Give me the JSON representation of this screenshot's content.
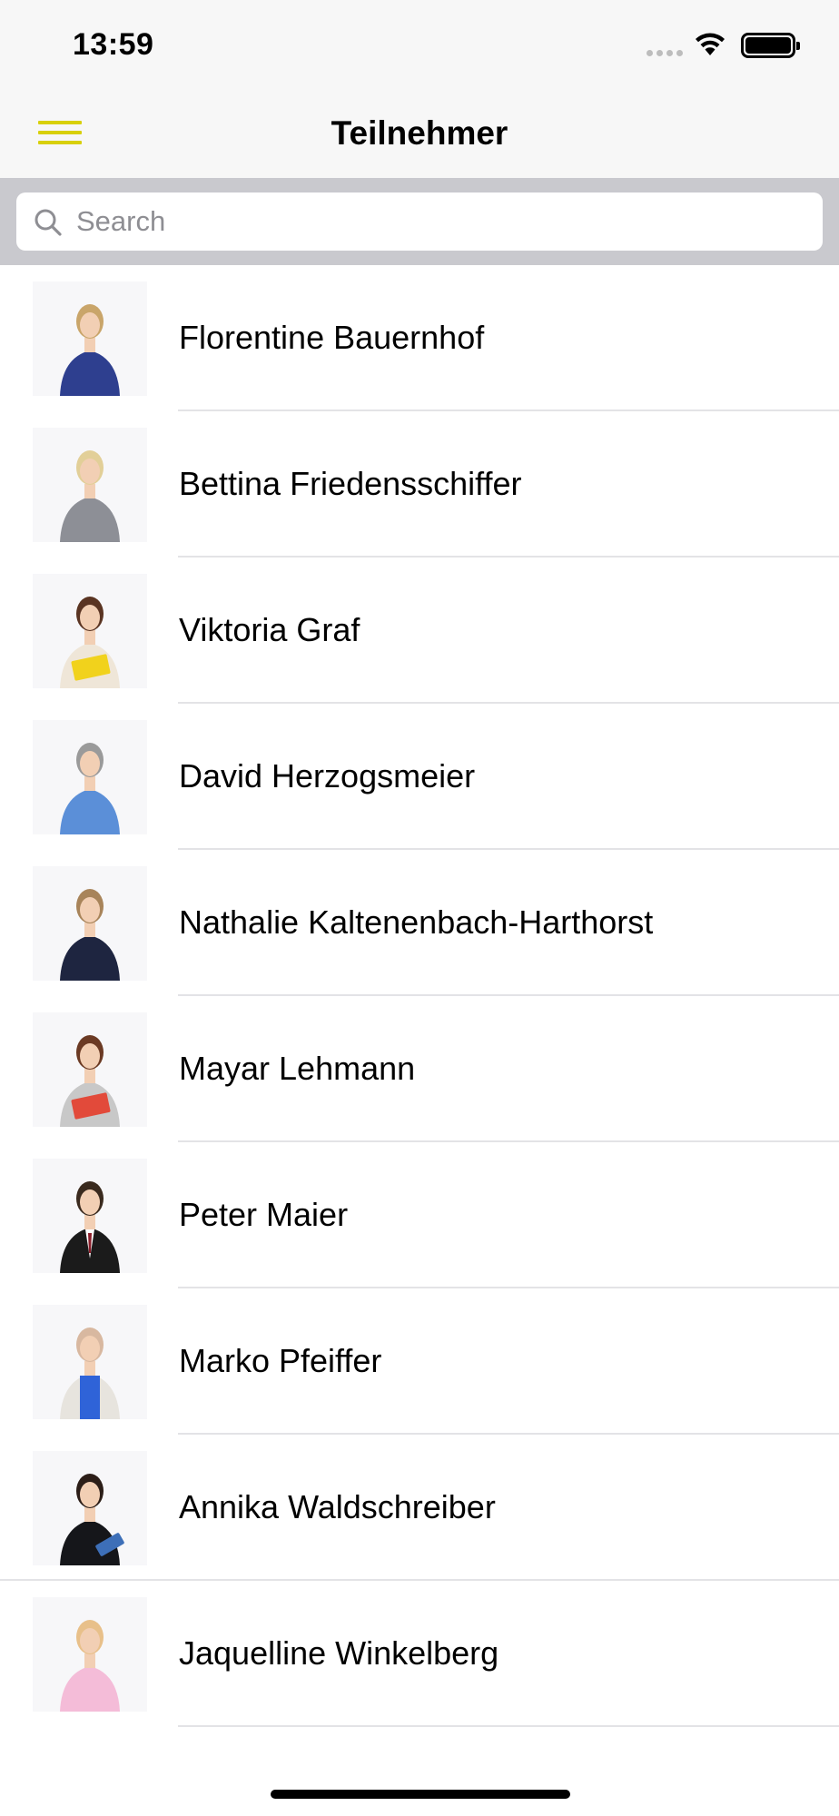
{
  "status_bar": {
    "time": "13:59"
  },
  "nav": {
    "title": "Teilnehmer",
    "menu_icon": "hamburger-menu-icon"
  },
  "search": {
    "placeholder": "Search",
    "value": ""
  },
  "participants": [
    {
      "name": "Florentine Bauernhof",
      "avatar": {
        "hair": "#c9a56a",
        "top": "#2e3f8f",
        "pose": "arms-crossed"
      }
    },
    {
      "name": "Bettina Friedensschiffer",
      "avatar": {
        "hair": "#e2cf98",
        "top": "#8d8f96",
        "pose": "standing"
      }
    },
    {
      "name": "Viktoria Graf",
      "avatar": {
        "hair": "#5a3422",
        "top": "#efe6d8",
        "pose": "folders",
        "prop": "#f1d21c"
      }
    },
    {
      "name": "David Herzogsmeier",
      "avatar": {
        "hair": "#9a9a9a",
        "top": "#5b8fd8",
        "pose": "arms-crossed"
      }
    },
    {
      "name": "Nathalie Kaltenenbach-Harthorst",
      "avatar": {
        "hair": "#a8845a",
        "top": "#1e2540",
        "pose": "hand-chin"
      }
    },
    {
      "name": "Mayar Lehmann",
      "avatar": {
        "hair": "#6b3a24",
        "top": "#c8c8c8",
        "pose": "folders",
        "prop": "#e24a3a"
      }
    },
    {
      "name": "Peter Maier",
      "avatar": {
        "hair": "#3a2a1e",
        "top": "#1b1b1b",
        "pose": "suit"
      }
    },
    {
      "name": "Marko Pfeiffer",
      "avatar": {
        "hair": "#d8b8a0",
        "top": "#e7e4de",
        "pose": "jacket",
        "prop": "#2f63d8"
      }
    },
    {
      "name": "Annika Waldschreiber",
      "avatar": {
        "hair": "#2c1e18",
        "top": "#15161a",
        "pose": "clipboard",
        "prop": "#3d6fb8"
      }
    },
    {
      "name": "Jaquelline Winkelberg",
      "avatar": {
        "hair": "#e8c08a",
        "top": "#f4bcd8",
        "pose": "arms-crossed"
      }
    }
  ]
}
